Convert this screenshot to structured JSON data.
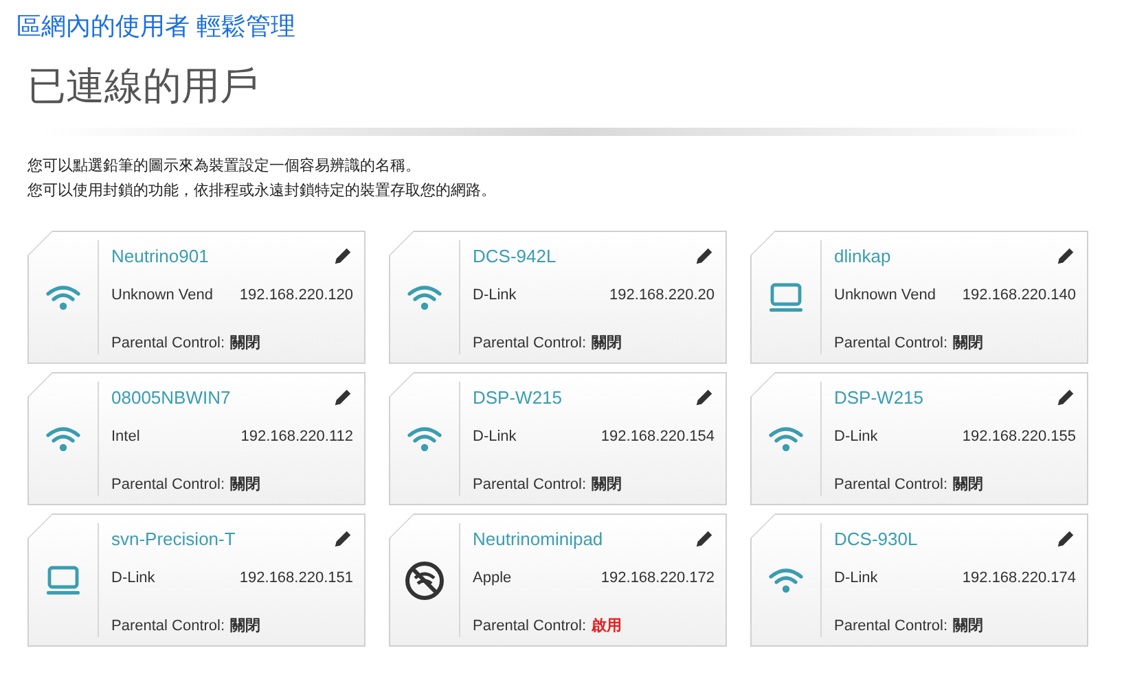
{
  "banner": {
    "title": "區網內的使用者 輕鬆管理"
  },
  "page": {
    "title": "已連線的用戶"
  },
  "instructions": [
    "您可以點選鉛筆的圖示來為裝置設定一個容易辨識的名稱。",
    "您可以使用封鎖的功能，依排程或永遠封鎖特定的裝置存取您的網路。"
  ],
  "devices": [
    {
      "name": "Neutrino901",
      "kind": "wifi",
      "vendor": "Unknown Vend",
      "ip": "192.168.220.120",
      "parental_label": "Parental Control:",
      "parental_state": "關閉",
      "parental_enabled": false
    },
    {
      "name": "DCS-942L",
      "kind": "wifi",
      "vendor": "D-Link",
      "ip": "192.168.220.20",
      "parental_label": "Parental Control:",
      "parental_state": "關閉",
      "parental_enabled": false
    },
    {
      "name": "dlinkap",
      "kind": "laptop",
      "vendor": "Unknown Vend",
      "ip": "192.168.220.140",
      "parental_label": "Parental Control:",
      "parental_state": "關閉",
      "parental_enabled": false
    },
    {
      "name": "08005NBWIN7",
      "kind": "wifi",
      "vendor": "Intel",
      "ip": "192.168.220.112",
      "parental_label": "Parental Control:",
      "parental_state": "關閉",
      "parental_enabled": false
    },
    {
      "name": "DSP-W215",
      "kind": "wifi",
      "vendor": "D-Link",
      "ip": "192.168.220.154",
      "parental_label": "Parental Control:",
      "parental_state": "關閉",
      "parental_enabled": false
    },
    {
      "name": "DSP-W215",
      "kind": "wifi",
      "vendor": "D-Link",
      "ip": "192.168.220.155",
      "parental_label": "Parental Control:",
      "parental_state": "關閉",
      "parental_enabled": false
    },
    {
      "name": "svn-Precision-T",
      "kind": "laptop",
      "vendor": "D-Link",
      "ip": "192.168.220.151",
      "parental_label": "Parental Control:",
      "parental_state": "關閉",
      "parental_enabled": false
    },
    {
      "name": "Neutrinominipad",
      "kind": "blocked",
      "vendor": "Apple",
      "ip": "192.168.220.172",
      "parental_label": "Parental Control:",
      "parental_state": "啟用",
      "parental_enabled": true
    },
    {
      "name": "DCS-930L",
      "kind": "wifi",
      "vendor": "D-Link",
      "ip": "192.168.220.174",
      "parental_label": "Parental Control:",
      "parental_state": "關閉",
      "parental_enabled": false
    }
  ]
}
